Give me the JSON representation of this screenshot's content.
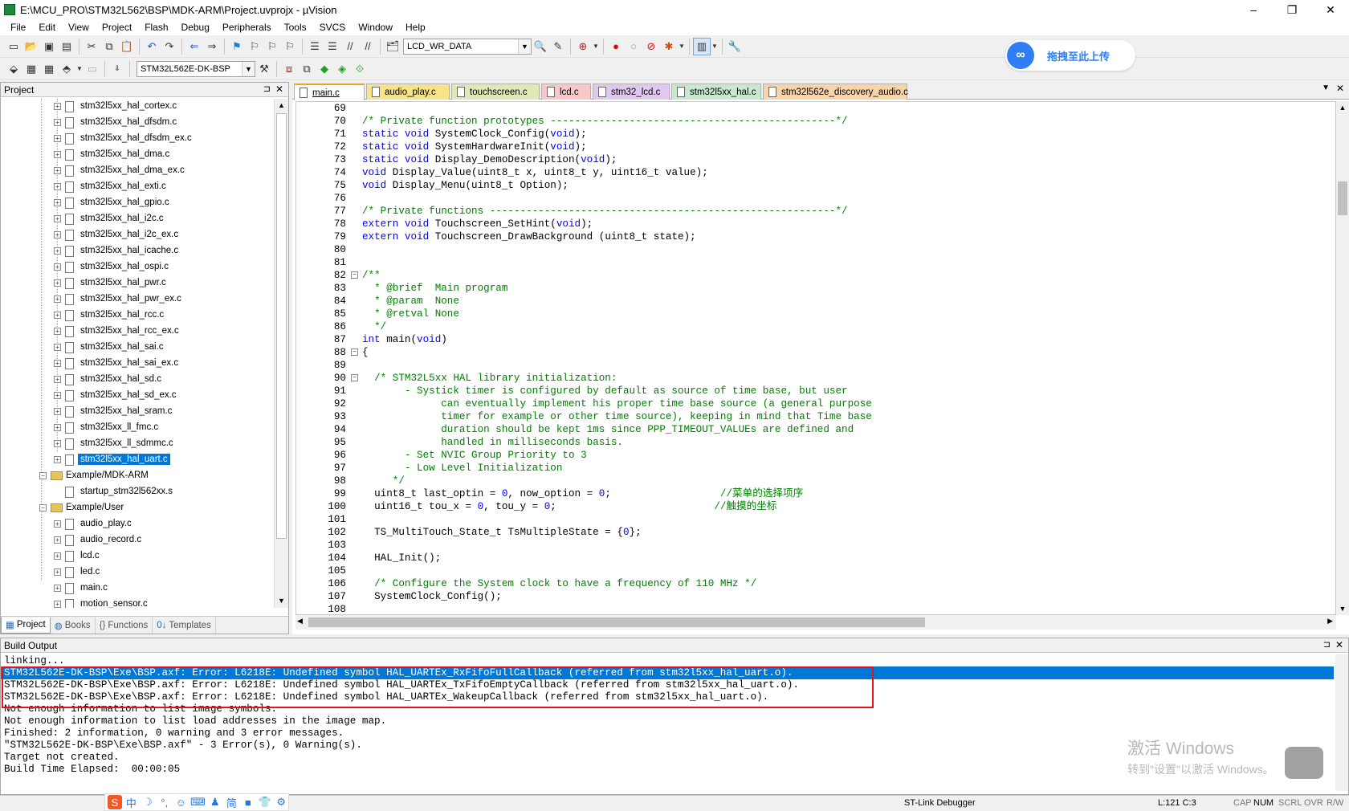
{
  "window": {
    "title": "E:\\MCU_PRO\\STM32L562\\BSP\\MDK-ARM\\Project.uvprojx - µVision",
    "minimize": "–",
    "restore": "❐",
    "close": "✕"
  },
  "menu": [
    "File",
    "Edit",
    "View",
    "Project",
    "Flash",
    "Debug",
    "Peripherals",
    "Tools",
    "SVCS",
    "Window",
    "Help"
  ],
  "toolbar1": {
    "find_combo": "LCD_WR_DATA"
  },
  "toolbar2": {
    "target_combo": "STM32L562E-DK-BSP"
  },
  "upload_widget": {
    "label": "拖拽至此上传"
  },
  "project_panel": {
    "title": "Project",
    "pin": "⊐",
    "close": "✕",
    "tree": [
      {
        "label": "stm32l5xx_hal_cortex.c",
        "type": "file",
        "level": 2
      },
      {
        "label": "stm32l5xx_hal_dfsdm.c",
        "type": "file",
        "level": 2
      },
      {
        "label": "stm32l5xx_hal_dfsdm_ex.c",
        "type": "file",
        "level": 2
      },
      {
        "label": "stm32l5xx_hal_dma.c",
        "type": "file",
        "level": 2
      },
      {
        "label": "stm32l5xx_hal_dma_ex.c",
        "type": "file",
        "level": 2
      },
      {
        "label": "stm32l5xx_hal_exti.c",
        "type": "file",
        "level": 2
      },
      {
        "label": "stm32l5xx_hal_gpio.c",
        "type": "file",
        "level": 2
      },
      {
        "label": "stm32l5xx_hal_i2c.c",
        "type": "file",
        "level": 2
      },
      {
        "label": "stm32l5xx_hal_i2c_ex.c",
        "type": "file",
        "level": 2
      },
      {
        "label": "stm32l5xx_hal_icache.c",
        "type": "file",
        "level": 2
      },
      {
        "label": "stm32l5xx_hal_ospi.c",
        "type": "file",
        "level": 2
      },
      {
        "label": "stm32l5xx_hal_pwr.c",
        "type": "file",
        "level": 2
      },
      {
        "label": "stm32l5xx_hal_pwr_ex.c",
        "type": "file",
        "level": 2
      },
      {
        "label": "stm32l5xx_hal_rcc.c",
        "type": "file",
        "level": 2
      },
      {
        "label": "stm32l5xx_hal_rcc_ex.c",
        "type": "file",
        "level": 2
      },
      {
        "label": "stm32l5xx_hal_sai.c",
        "type": "file",
        "level": 2
      },
      {
        "label": "stm32l5xx_hal_sai_ex.c",
        "type": "file",
        "level": 2
      },
      {
        "label": "stm32l5xx_hal_sd.c",
        "type": "file",
        "level": 2
      },
      {
        "label": "stm32l5xx_hal_sd_ex.c",
        "type": "file",
        "level": 2
      },
      {
        "label": "stm32l5xx_hal_sram.c",
        "type": "file",
        "level": 2
      },
      {
        "label": "stm32l5xx_ll_fmc.c",
        "type": "file",
        "level": 2
      },
      {
        "label": "stm32l5xx_ll_sdmmc.c",
        "type": "file",
        "level": 2
      },
      {
        "label": "stm32l5xx_hal_uart.c",
        "type": "file",
        "level": 2,
        "selected": true
      },
      {
        "label": "Example/MDK-ARM",
        "type": "folder",
        "level": 1
      },
      {
        "label": "startup_stm32l562xx.s",
        "type": "file",
        "level": 2,
        "noexpand": true
      },
      {
        "label": "Example/User",
        "type": "folder",
        "level": 1
      },
      {
        "label": "audio_play.c",
        "type": "file",
        "level": 2
      },
      {
        "label": "audio_record.c",
        "type": "file",
        "level": 2
      },
      {
        "label": "lcd.c",
        "type": "file",
        "level": 2
      },
      {
        "label": "led.c",
        "type": "file",
        "level": 2
      },
      {
        "label": "main.c",
        "type": "file",
        "level": 2
      },
      {
        "label": "motion_sensor.c",
        "type": "file",
        "level": 2
      }
    ],
    "tabs": [
      {
        "label": "Project",
        "active": true,
        "icon": "▦"
      },
      {
        "label": "Books",
        "active": false,
        "icon": "◍"
      },
      {
        "label": "Functions",
        "active": false,
        "icon": "{}"
      },
      {
        "label": "Templates",
        "active": false,
        "icon": "0↓"
      }
    ]
  },
  "editor": {
    "tabs": [
      {
        "label": "main.c",
        "active": true,
        "color": "#ffffff"
      },
      {
        "label": "audio_play.c",
        "active": false,
        "color": "#f7e48a"
      },
      {
        "label": "touchscreen.c",
        "active": false,
        "color": "#e0e8b8"
      },
      {
        "label": "lcd.c",
        "active": false,
        "color": "#f8c8c8"
      },
      {
        "label": "stm32_lcd.c",
        "active": false,
        "color": "#e0c8f0"
      },
      {
        "label": "stm32l5xx_hal.c",
        "active": false,
        "color": "#c8e8d0"
      },
      {
        "label": "stm32l562e_discovery_audio.c",
        "active": false,
        "color": "#f8d4a8"
      }
    ],
    "lines": [
      {
        "n": "69",
        "segs": []
      },
      {
        "n": "70",
        "segs": [
          {
            "t": "/* Private function prototypes -----------------------------------------------*/",
            "c": "cm"
          }
        ]
      },
      {
        "n": "71",
        "segs": [
          {
            "t": "static void ",
            "c": "kw"
          },
          {
            "t": "SystemClock_Config(",
            "c": "st"
          },
          {
            "t": "void",
            "c": "kw"
          },
          {
            "t": ");",
            "c": "st"
          }
        ]
      },
      {
        "n": "72",
        "segs": [
          {
            "t": "static void ",
            "c": "kw"
          },
          {
            "t": "SystemHardwareInit(",
            "c": "st"
          },
          {
            "t": "void",
            "c": "kw"
          },
          {
            "t": ");",
            "c": "st"
          }
        ]
      },
      {
        "n": "73",
        "segs": [
          {
            "t": "static void ",
            "c": "kw"
          },
          {
            "t": "Display_DemoDescription(",
            "c": "st"
          },
          {
            "t": "void",
            "c": "kw"
          },
          {
            "t": ");",
            "c": "st"
          }
        ]
      },
      {
        "n": "74",
        "segs": [
          {
            "t": "void ",
            "c": "kw"
          },
          {
            "t": "Display_Value(uint8_t x, uint8_t y, uint16_t value);",
            "c": "st"
          }
        ]
      },
      {
        "n": "75",
        "segs": [
          {
            "t": "void ",
            "c": "kw"
          },
          {
            "t": "Display_Menu(uint8_t Option);",
            "c": "st"
          }
        ]
      },
      {
        "n": "76",
        "segs": []
      },
      {
        "n": "77",
        "segs": [
          {
            "t": "/* Private functions ---------------------------------------------------------*/",
            "c": "cm"
          }
        ]
      },
      {
        "n": "78",
        "segs": [
          {
            "t": "extern void ",
            "c": "kw"
          },
          {
            "t": "Touchscreen_SetHint(",
            "c": "st"
          },
          {
            "t": "void",
            "c": "kw"
          },
          {
            "t": ");",
            "c": "st"
          }
        ]
      },
      {
        "n": "79",
        "segs": [
          {
            "t": "extern void ",
            "c": "kw"
          },
          {
            "t": "Touchscreen_DrawBackground (uint8_t state);",
            "c": "st"
          }
        ]
      },
      {
        "n": "80",
        "segs": []
      },
      {
        "n": "81",
        "segs": []
      },
      {
        "n": "82",
        "fold": "−",
        "segs": [
          {
            "t": "/**",
            "c": "cm"
          }
        ]
      },
      {
        "n": "83",
        "segs": [
          {
            "t": "  * @brief  Main program",
            "c": "cm"
          }
        ]
      },
      {
        "n": "84",
        "segs": [
          {
            "t": "  * @param  None",
            "c": "cm"
          }
        ]
      },
      {
        "n": "85",
        "segs": [
          {
            "t": "  * @retval None",
            "c": "cm"
          }
        ]
      },
      {
        "n": "86",
        "segs": [
          {
            "t": "  */",
            "c": "cm"
          }
        ]
      },
      {
        "n": "87",
        "segs": [
          {
            "t": "int ",
            "c": "kw"
          },
          {
            "t": "main(",
            "c": "st"
          },
          {
            "t": "void",
            "c": "kw"
          },
          {
            "t": ")",
            "c": "st"
          }
        ]
      },
      {
        "n": "88",
        "fold": "−",
        "segs": [
          {
            "t": "{",
            "c": "st"
          }
        ]
      },
      {
        "n": "89",
        "segs": []
      },
      {
        "n": "90",
        "fold": "−",
        "segs": [
          {
            "t": "  /* STM32L5xx HAL library initialization:",
            "c": "cm"
          }
        ]
      },
      {
        "n": "91",
        "segs": [
          {
            "t": "       - Systick timer is configured by default as source of time base, but user",
            "c": "cm"
          }
        ]
      },
      {
        "n": "92",
        "segs": [
          {
            "t": "             can eventually implement his proper time base source (a general purpose",
            "c": "cm"
          }
        ]
      },
      {
        "n": "93",
        "segs": [
          {
            "t": "             timer for example or other time source), keeping in mind that Time base",
            "c": "cm"
          }
        ]
      },
      {
        "n": "94",
        "segs": [
          {
            "t": "             duration should be kept 1ms since PPP_TIMEOUT_VALUEs are defined and",
            "c": "cm"
          }
        ]
      },
      {
        "n": "95",
        "segs": [
          {
            "t": "             handled in milliseconds basis.",
            "c": "cm"
          }
        ]
      },
      {
        "n": "96",
        "segs": [
          {
            "t": "       - Set NVIC Group Priority to 3",
            "c": "cm"
          }
        ]
      },
      {
        "n": "97",
        "segs": [
          {
            "t": "       - Low Level Initialization",
            "c": "cm"
          }
        ]
      },
      {
        "n": "98",
        "segs": [
          {
            "t": "     */",
            "c": "cm"
          }
        ]
      },
      {
        "n": "99",
        "segs": [
          {
            "t": "  uint8_t last_optin = ",
            "c": "st"
          },
          {
            "t": "0",
            "c": "kw"
          },
          {
            "t": ", now_option = ",
            "c": "st"
          },
          {
            "t": "0",
            "c": "kw"
          },
          {
            "t": ";                  ",
            "c": "st"
          },
          {
            "t": "//菜单的选择项序",
            "c": "cm"
          }
        ]
      },
      {
        "n": "100",
        "segs": [
          {
            "t": "  uint16_t tou_x = ",
            "c": "st"
          },
          {
            "t": "0",
            "c": "kw"
          },
          {
            "t": ", tou_y = ",
            "c": "st"
          },
          {
            "t": "0",
            "c": "kw"
          },
          {
            "t": ";                          ",
            "c": "st"
          },
          {
            "t": "//触摸的坐标",
            "c": "cm"
          }
        ]
      },
      {
        "n": "101",
        "segs": []
      },
      {
        "n": "102",
        "segs": [
          {
            "t": "  TS_MultiTouch_State_t TsMultipleState = {",
            "c": "st"
          },
          {
            "t": "0",
            "c": "kw"
          },
          {
            "t": "};",
            "c": "st"
          }
        ]
      },
      {
        "n": "103",
        "segs": []
      },
      {
        "n": "104",
        "segs": [
          {
            "t": "  HAL_Init();",
            "c": "st"
          }
        ]
      },
      {
        "n": "105",
        "segs": []
      },
      {
        "n": "106",
        "segs": [
          {
            "t": "  /* Configure the System clock to have a frequency of 110 MHz */",
            "c": "cm"
          }
        ]
      },
      {
        "n": "107",
        "segs": [
          {
            "t": "  SystemClock_Config();",
            "c": "st"
          }
        ]
      },
      {
        "n": "108",
        "segs": []
      }
    ]
  },
  "build_output": {
    "title": "Build Output",
    "pin": "⊐",
    "close": "✕",
    "lines": [
      {
        "text": "linking...",
        "selected": false
      },
      {
        "text": "STM32L562E-DK-BSP\\Exe\\BSP.axf: Error: L6218E: Undefined symbol HAL_UARTEx_RxFifoFullCallback (referred from stm32l5xx_hal_uart.o).",
        "selected": true
      },
      {
        "text": "STM32L562E-DK-BSP\\Exe\\BSP.axf: Error: L6218E: Undefined symbol HAL_UARTEx_TxFifoEmptyCallback (referred from stm32l5xx_hal_uart.o).",
        "selected": false
      },
      {
        "text": "STM32L562E-DK-BSP\\Exe\\BSP.axf: Error: L6218E: Undefined symbol HAL_UARTEx_WakeupCallback (referred from stm32l5xx_hal_uart.o).",
        "selected": false
      },
      {
        "text": "Not enough information to list image symbols.",
        "selected": false
      },
      {
        "text": "Not enough information to list load addresses in the image map.",
        "selected": false
      },
      {
        "text": "Finished: 2 information, 0 warning and 3 error messages.",
        "selected": false
      },
      {
        "text": "\"STM32L562E-DK-BSP\\Exe\\BSP.axf\" - 3 Error(s), 0 Warning(s).",
        "selected": false
      },
      {
        "text": "Target not created.",
        "selected": false
      },
      {
        "text": "Build Time Elapsed:  00:00:05",
        "selected": false
      }
    ]
  },
  "watermark": {
    "line1": "激活 Windows",
    "line2": "转到\"设置\"以激活 Windows。"
  },
  "statusbar": {
    "debugger": "ST-Link Debugger",
    "position": "L:121 C:3",
    "cap": "CAP",
    "num": "NUM",
    "scrl": "SCRL",
    "ovr": "OVR",
    "rw": "R/W"
  },
  "ime": {
    "items": [
      "中",
      "☽",
      "°,",
      "☺",
      "⌨",
      "♟",
      "简",
      "■",
      "👕",
      "⚙"
    ]
  },
  "colors": {
    "selection": "#0078d7",
    "keyword": "#0000ff",
    "comment": "#008000",
    "error_box": "#e0151c"
  }
}
